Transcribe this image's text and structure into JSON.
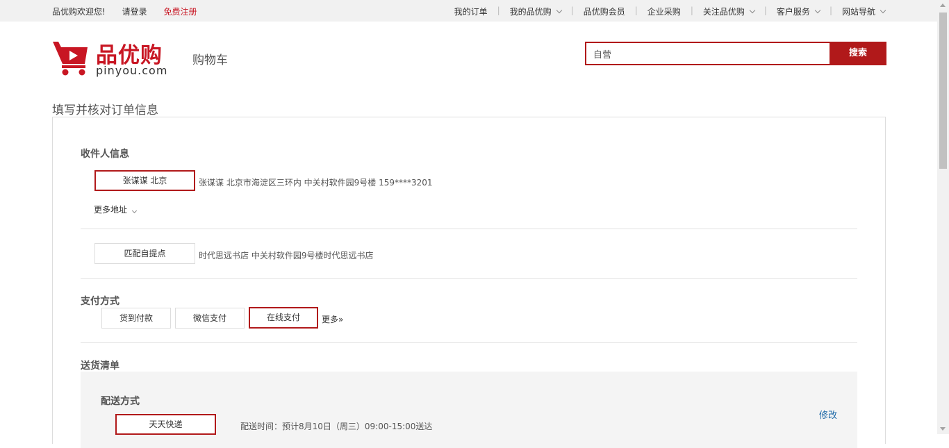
{
  "topbar": {
    "welcome": "品优购欢迎您!",
    "login": "请登录",
    "register": "免费注册",
    "nav": [
      {
        "label": "我的订单",
        "dropdown": false
      },
      {
        "label": "我的品优购",
        "dropdown": true
      },
      {
        "label": "品优购会员",
        "dropdown": false
      },
      {
        "label": "企业采购",
        "dropdown": false
      },
      {
        "label": "关注品优购",
        "dropdown": true
      },
      {
        "label": "客户服务",
        "dropdown": true
      },
      {
        "label": "网站导航",
        "dropdown": true
      }
    ]
  },
  "header": {
    "logo_text": "品优购",
    "logo_domain": "pinyou.com",
    "page_name": "购物车",
    "search_value": "自营",
    "search_button": "搜索"
  },
  "page_title": "填写并核对订单信息",
  "receiver": {
    "title": "收件人信息",
    "selected": "张谋谋 北京",
    "address": "张谋谋 北京市海淀区三环内 中关村软件园9号楼 159****3201",
    "more": "更多地址"
  },
  "pickup": {
    "button": "匹配自提点",
    "address": "时代思远书店 中关村软件园9号楼时代思远书店"
  },
  "payment": {
    "title": "支付方式",
    "options": [
      "货到付款",
      "微信支付",
      "在线支付"
    ],
    "selected_index": 2,
    "more": "更多»"
  },
  "shipping": {
    "title": "送货清单",
    "method_title": "配送方式",
    "method": "天天快递",
    "time": "配送时间：预计8月10日（周三）09:00-15:00送达",
    "edit": "修改"
  },
  "colors": {
    "accent": "#b1191a",
    "register": "#c81623",
    "link": "#1f6aa8"
  }
}
